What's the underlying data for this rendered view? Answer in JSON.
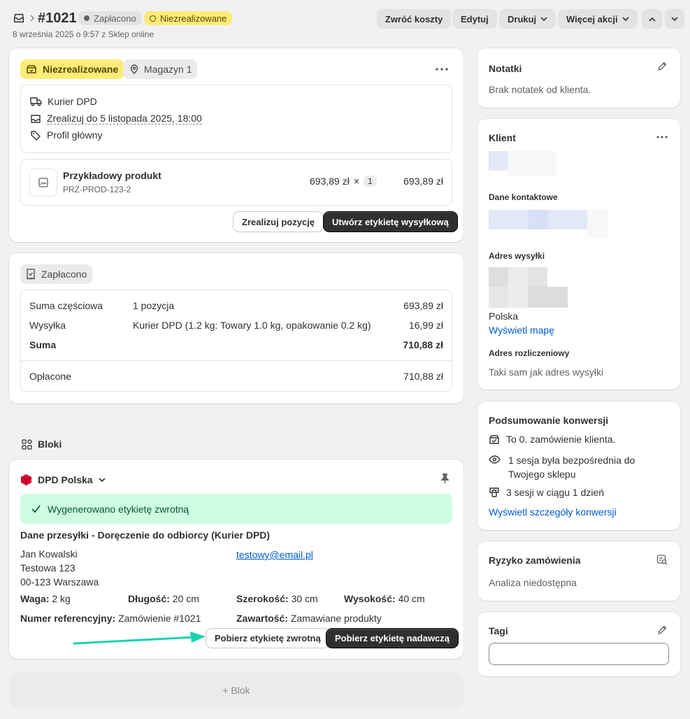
{
  "header": {
    "order_number": "#1021",
    "paid_badge": "Zapłacono",
    "unfulfilled_badge": "Niezrealizowane",
    "subtitle": "8 września 2025 o 9:57 z Sklep online",
    "actions": {
      "refund": "Zwróć koszty",
      "edit": "Edytuj",
      "print": "Drukuj",
      "more": "Więcej akcji"
    }
  },
  "fulfillment": {
    "status": "Niezrealizowane",
    "location": "Magazyn 1",
    "shipping_method": "Kurier DPD",
    "deadline": "Zrealizuj do 5 listopada 2025, 18:00",
    "profile": "Profil główny",
    "product": {
      "name": "Przykładowy produkt",
      "sku": "PRZ-PROD-123-2",
      "price": "693,89 zł",
      "times": "×",
      "quantity": "1",
      "total": "693,89 zł"
    },
    "fulfill_button": "Zrealizuj pozycję",
    "label_button": "Utwórz etykietę wysyłkową"
  },
  "payment": {
    "status": "Zapłacono",
    "rows": [
      {
        "label": "Suma częściowa",
        "desc": "1 pozycja",
        "amount": "693,89 zł"
      },
      {
        "label": "Wysyłka",
        "desc": "Kurier DPD (1.2 kg: Towary 1.0 kg, opakowanie 0.2 kg)",
        "amount": "16,99 zł"
      },
      {
        "label": "Suma",
        "desc": "",
        "amount": "710,88 zł"
      }
    ],
    "paid_label": "Opłacone",
    "paid_amount": "710,88 zł"
  },
  "blocks": {
    "title": "Bloki",
    "app_name": "DPD Polska",
    "success_message": "Wygenerowano etykietę zwrotną",
    "shipment_title": "Dane przesyłki - Doręczenie do odbiorcy (Kurier DPD)",
    "recipient": {
      "name": "Jan Kowalski",
      "street": "Testowa 123",
      "city": "00-123 Warszawa",
      "email": "testowy@email.pl"
    },
    "weight_label": "Waga:",
    "weight": "2 kg",
    "length_label": "Długość:",
    "length": "20 cm",
    "width_label": "Szerokość:",
    "width": "30 cm",
    "height_label": "Wysokość:",
    "height": "40 cm",
    "reference_label": "Numer referencyjny:",
    "reference": "Zamówienie #1021",
    "contents_label": "Zawartość:",
    "contents": "Zamawiane produkty",
    "return_label_button": "Pobierz etykietę zwrotną",
    "sender_label_button": "Pobierz etykietę nadawczą",
    "add_block": "+ Blok"
  },
  "notes": {
    "title": "Notatki",
    "text": "Brak notatek od klienta."
  },
  "customer": {
    "title": "Klient",
    "contact_title": "Dane kontaktowe",
    "shipping_title": "Adres wysyłki",
    "country": "Polska",
    "map_link": "Wyświetl mapę",
    "billing_title": "Adres rozliczeniowy",
    "billing_text": "Taki sam jak adres wysyłki"
  },
  "conversion": {
    "title": "Podsumowanie konwersji",
    "items": [
      "To 0. zamówienie klienta.",
      "1 sesja była bezpośrednia do Twojego sklepu",
      "3 sesji w ciągu 1 dzień"
    ],
    "link": "Wyświetl szczegóły konwersji"
  },
  "risk": {
    "title": "Ryzyko zamówienia",
    "text": "Analiza niedostępna"
  },
  "tags": {
    "title": "Tagi",
    "input_value": ""
  },
  "colors": {
    "success_bg": "#cdfee1",
    "attention_bg": "#ffeb78",
    "dark_button": "#303030",
    "link": "#005bd3",
    "arrow": "#19d3b0",
    "dpd_red": "#dc0032"
  }
}
